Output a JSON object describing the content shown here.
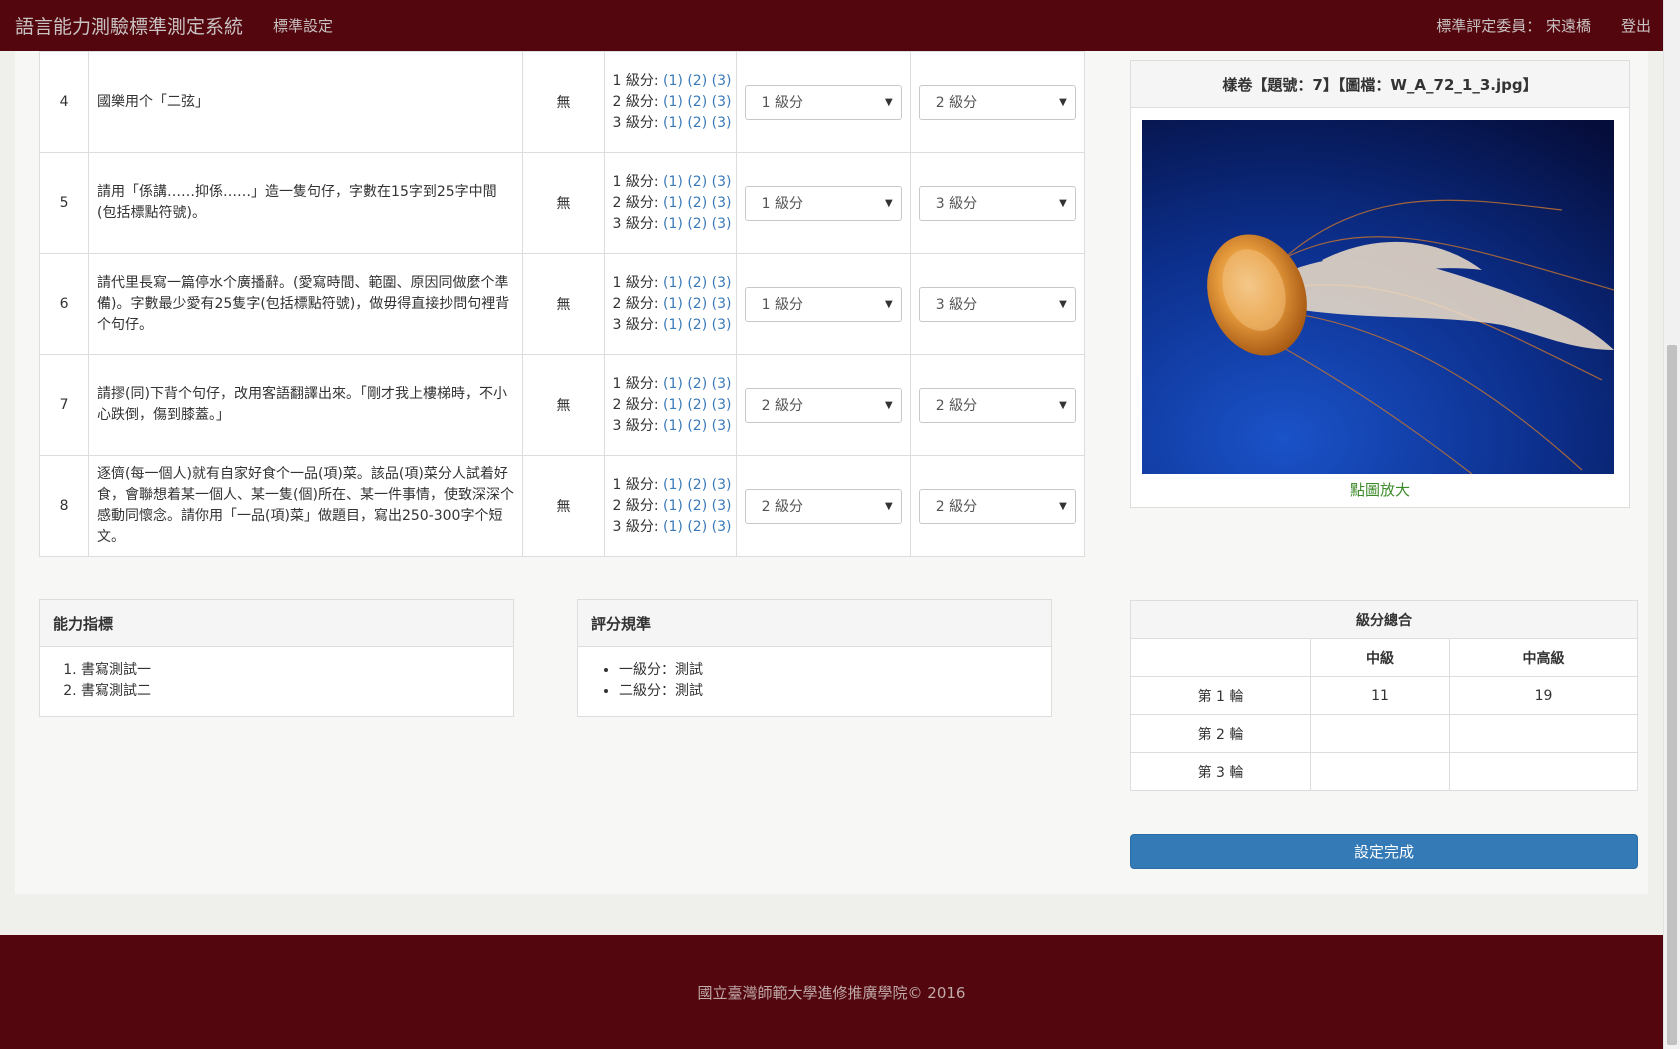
{
  "navbar": {
    "brand": "語言能力測驗標準測定系統",
    "nav_link": "標準設定",
    "user_label": "標準評定委員： 宋遠橋",
    "logout": "登出"
  },
  "questions": [
    {
      "num": "4",
      "text": "國樂用个「二弦」",
      "none": "無",
      "select1": "1 級分",
      "select2": "2 級分"
    },
    {
      "num": "5",
      "text": "請用「係講……抑係……」造一隻句仔，字數在15字到25字中間(包括標點符號)。",
      "none": "無",
      "select1": "1 級分",
      "select2": "3 級分"
    },
    {
      "num": "6",
      "text": "請代里長寫一篇停水个廣播辭。(愛寫時間、範圍、原因同做麼个準備)。字數最少愛有25隻字(包括標點符號)，做毋得直接抄問句裡背个句仔。",
      "none": "無",
      "select1": "1 級分",
      "select2": "3 級分"
    },
    {
      "num": "7",
      "text": "請摎(同)下背个句仔，改用客語翻譯出來。「剛才我上樓梯時，不小心跌倒，傷到膝蓋。」",
      "none": "無",
      "select1": "2 級分",
      "select2": "2 級分"
    },
    {
      "num": "8",
      "text": "逐儕(每一個人)就有自家好食个一品(項)菜。該品(項)菜分人試着好食，會聯想着某一個人、某一隻(個)所在、某一件事情，使致深深个感動同懷念。請你用「一品(項)菜」做題目，寫出250-300字个短文。",
      "none": "無",
      "select1": "2 級分",
      "select2": "2 級分"
    }
  ],
  "level_links": {
    "row1": "1 級分:",
    "row2": "2 級分:",
    "row3": "3 級分:",
    "l1": "(1)",
    "l2": "(2)",
    "l3": "(3)"
  },
  "sample": {
    "title": "樣卷【題號：7】【圖檔：W_A_72_1_3.jpg】",
    "enlarge": "點圖放大"
  },
  "ability_panel": {
    "title": "能力指標",
    "items": [
      "書寫測試一",
      "書寫測試二"
    ]
  },
  "rubric_panel": {
    "title": "評分規準",
    "items": [
      "一級分：測試",
      "二級分：測試"
    ]
  },
  "summary": {
    "title": "級分總合",
    "col1": "中級",
    "col2": "中高級",
    "rows": [
      {
        "label": "第 1 輪",
        "mid": "11",
        "high": "19"
      },
      {
        "label": "第 2 輪",
        "mid": "",
        "high": ""
      },
      {
        "label": "第 3 輪",
        "mid": "",
        "high": ""
      }
    ]
  },
  "done_button": "設定完成",
  "footer": "國立臺灣師範大學進修推廣學院© 2016",
  "colors": {
    "navbar": "#53060d",
    "primary": "#337ab7",
    "link": "#3a7ab8",
    "enlarge": "#3d8a29"
  }
}
